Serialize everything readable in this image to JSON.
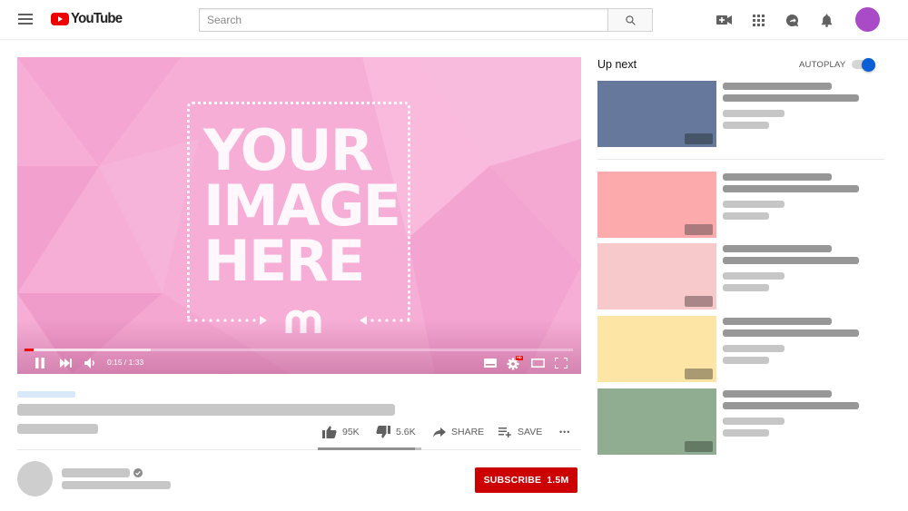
{
  "header": {
    "logo_text": "YouTube",
    "search_placeholder": "Search",
    "icons": [
      "menu-icon",
      "search-icon",
      "video-camera-add-icon",
      "apps-grid-icon",
      "messages-icon",
      "notifications-bell-icon",
      "account-avatar"
    ],
    "avatar_color": "#a94bc7",
    "brand_color": "#ee0000"
  },
  "player": {
    "placeholder_lines": [
      "YOUR",
      "IMAGE",
      "HERE"
    ],
    "watermark": "m",
    "current_time": "0:15",
    "duration": "1:33",
    "time_display": "0:15 / 1:33",
    "played_fraction": 0.16,
    "buffered_fraction": 0.23,
    "hd_badge": "HD",
    "controls": [
      "pause",
      "next",
      "volume",
      "subtitles",
      "settings",
      "theater-mode",
      "fullscreen"
    ]
  },
  "video": {
    "likes": "95K",
    "dislikes": "5.6K",
    "like_fraction": 0.94,
    "share_label": "SHARE",
    "save_label": "SAVE",
    "more_label": "•••"
  },
  "channel": {
    "verified": true,
    "subscribe_label": "SUBSCRIBE",
    "subscriber_count": "1.5M",
    "subscribe_color": "#cc0000"
  },
  "sidebar": {
    "up_next_label": "Up next",
    "autoplay_label": "AUTOPLAY",
    "autoplay_on": true,
    "toggle_color": "#0b5fd6",
    "recommendations": [
      {
        "thumb_color": "#66799c",
        "badge_color": "#475569"
      },
      {
        "thumb_color": "#fdaaad",
        "badge_color": "#ab7a7c"
      },
      {
        "thumb_color": "#f8c9cb",
        "badge_color": "#a98788"
      },
      {
        "thumb_color": "#fde5a6",
        "badge_color": "#a99a72"
      },
      {
        "thumb_color": "#91ad91",
        "badge_color": "#647a64"
      }
    ]
  }
}
